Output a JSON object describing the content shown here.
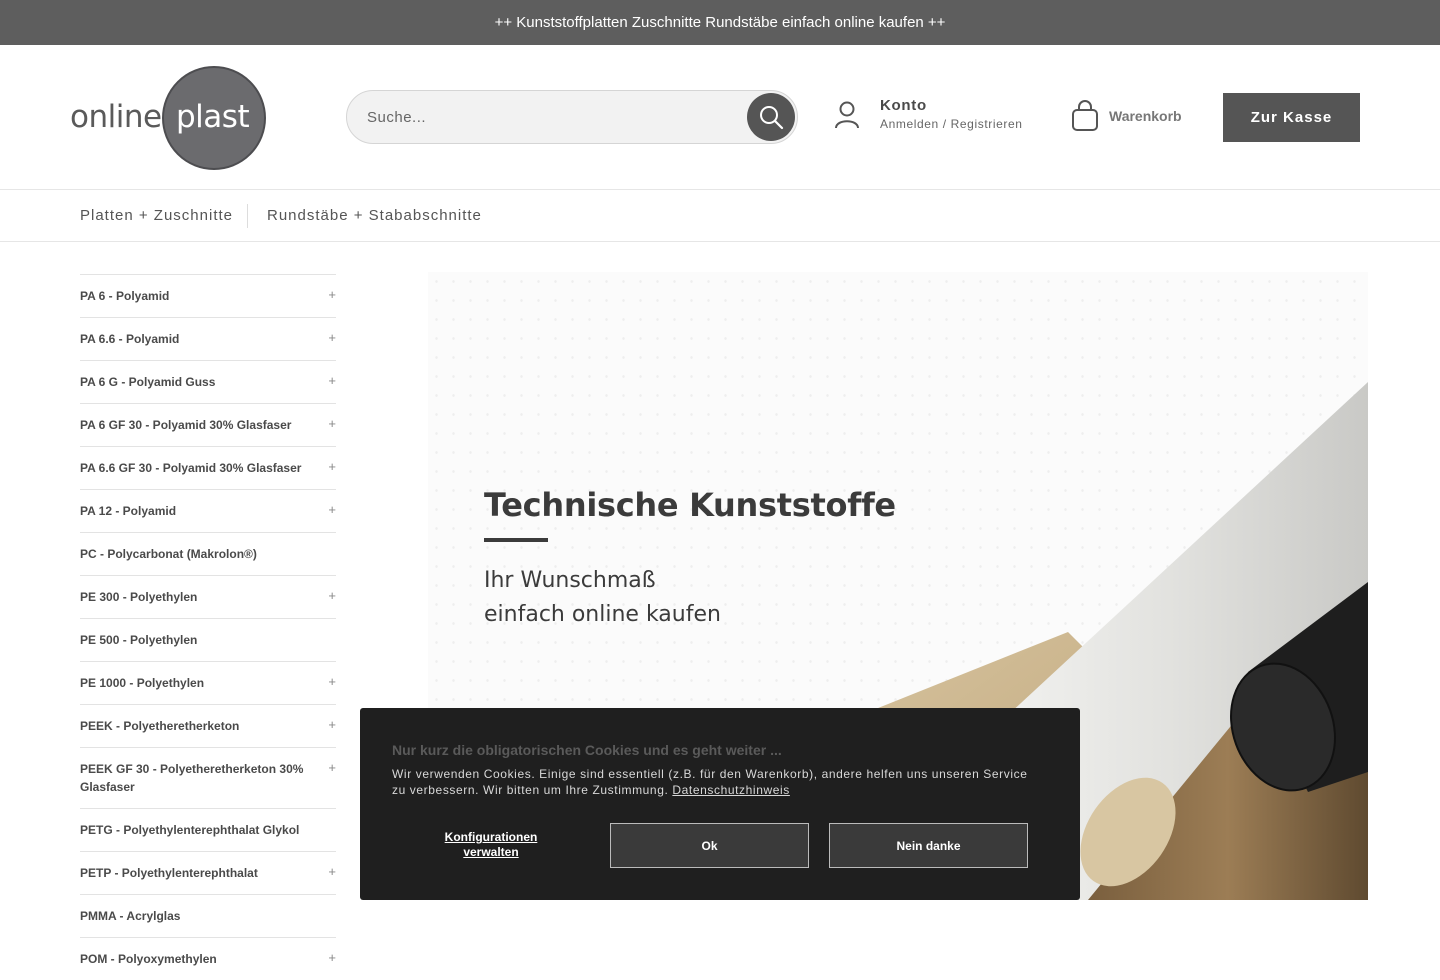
{
  "topbar": {
    "text": "++ Kunststoffplatten Zuschnitte Rundstäbe einfach online kaufen ++"
  },
  "logo": {
    "part1": "online",
    "part2": "plast"
  },
  "search": {
    "placeholder": "Suche..."
  },
  "account": {
    "title": "Konto",
    "subtitle": "Anmelden / Registrieren"
  },
  "cart": {
    "label": "Warenkorb"
  },
  "checkout": {
    "label": "Zur Kasse"
  },
  "nav": {
    "items": [
      "Platten + Zuschnitte",
      "Rundstäbe + Stababschnitte"
    ]
  },
  "sidebar": {
    "items": [
      {
        "label": "PA 6 - Polyamid",
        "plus": "+"
      },
      {
        "label": "PA 6.6 - Polyamid",
        "plus": "+"
      },
      {
        "label": "PA 6 G - Polyamid Guss",
        "plus": "+"
      },
      {
        "label": "PA 6 GF 30 - Polyamid 30% Glasfaser",
        "plus": "+"
      },
      {
        "label": "PA 6.6 GF 30 - Polyamid 30% Glasfaser",
        "plus": "+"
      },
      {
        "label": "PA 12 - Polyamid",
        "plus": "+"
      },
      {
        "label": "PC - Polycarbonat (Makrolon®)",
        "plus": ""
      },
      {
        "label": "PE 300 - Polyethylen",
        "plus": "+"
      },
      {
        "label": "PE 500 - Polyethylen",
        "plus": ""
      },
      {
        "label": "PE 1000 - Polyethylen",
        "plus": "+"
      },
      {
        "label": "PEEK - Polyetheretherketon",
        "plus": "+"
      },
      {
        "label": "PEEK GF 30 - Polyetheretherketon 30% Glasfaser",
        "plus": "+"
      },
      {
        "label": "PETG - Polyethylenterephthalat Glykol",
        "plus": ""
      },
      {
        "label": "PETP - Polyethylenterephthalat",
        "plus": "+"
      },
      {
        "label": "PMMA - Acrylglas",
        "plus": ""
      },
      {
        "label": "POM - Polyoxymethylen",
        "plus": "+"
      }
    ]
  },
  "hero": {
    "title": "Technische Kunststoffe",
    "line1": "Ihr Wunschmaß",
    "line2": "einfach online kaufen"
  },
  "cookie": {
    "title": "Nur kurz die obligatorischen Cookies und es geht weiter ...",
    "text": "Wir verwenden Cookies. Einige sind essentiell (z.B. für den Warenkorb), andere helfen uns unseren Service zu verbessern. Wir bitten um Ihre Zustimmung.",
    "privacy_link": "Datenschutzhinweis",
    "config_label": "Konfigurationen verwalten",
    "ok_label": "Ok",
    "decline_label": "Nein danke"
  },
  "colors": {
    "topbar": "#5e5e5e",
    "accent": "#555555",
    "cookie_bg": "#1f1f1f"
  }
}
